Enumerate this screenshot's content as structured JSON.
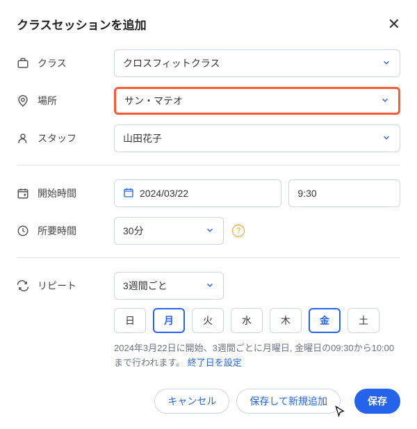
{
  "title": "クラスセッションを追加",
  "fields": {
    "class": {
      "label": "クラス",
      "value": "クロスフィットクラス"
    },
    "location": {
      "label": "場所",
      "value": "サン・マテオ"
    },
    "staff": {
      "label": "スタッフ",
      "value": "山田花子"
    },
    "start_time": {
      "label": "開始時間",
      "date": "2024/03/22",
      "time": "9:30"
    },
    "duration": {
      "label": "所要時間",
      "value": "30分"
    },
    "repeat": {
      "label": "リピート",
      "value": "3週間ごと"
    }
  },
  "days": {
    "sun": "日",
    "mon": "月",
    "tue": "火",
    "wed": "水",
    "thu": "木",
    "fri": "金",
    "sat": "土"
  },
  "description": {
    "text": "2024年3月22日に開始、3週間ごとに月曜日, 金曜日の09:30から10:00まで行われます。",
    "link": "終了日を設定"
  },
  "buttons": {
    "cancel": "キャンセル",
    "save_new": "保存して新規追加",
    "save": "保存"
  },
  "help_q": "?"
}
